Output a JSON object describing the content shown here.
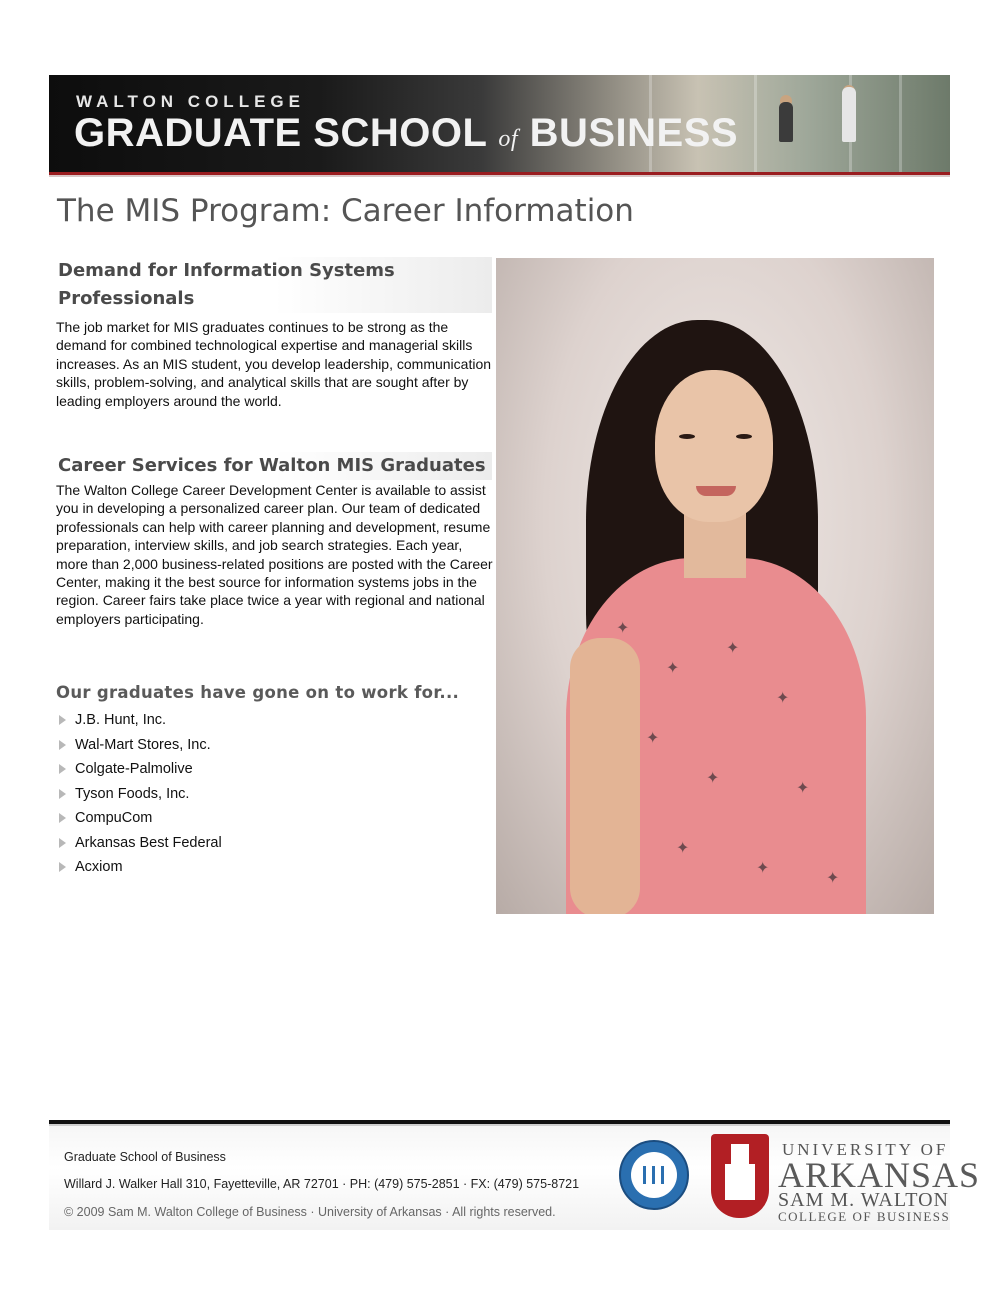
{
  "banner": {
    "kicker": "WALTON COLLEGE",
    "title_part1": "GRADUATE SCHOOL ",
    "title_of": "of",
    "title_part2": " BUSINESS"
  },
  "page_title": "The MIS Program: Career Information",
  "sections": [
    {
      "heading_line1": "Demand for Information Systems",
      "heading_line2": "Professionals",
      "body": "The job market for MIS graduates continues to be strong as the demand for combined technological expertise and managerial skills increases.  As an MIS student, you develop leadership, communication skills, problem-solving, and analytical skills that are sought after by leading employers around the world."
    },
    {
      "heading": "Career Services for Walton MIS Graduates",
      "body": "The Walton College Career Development Center is available to assist you in developing a personalized career plan. Our team of dedicated professionals can help with career planning and development, resume preparation, interview skills, and job search strategies.     Each year, more than 2,000 business-related positions are posted with the Career Center, making it the best source for information systems jobs in the region.  Career fairs take place twice a year with regional and national employers participating."
    }
  ],
  "graduates": {
    "heading": "Our graduates have gone on to work for...",
    "employers": [
      "J.B. Hunt, Inc.",
      "Wal-Mart Stores, Inc.",
      "Colgate-Palmolive",
      "Tyson Foods, Inc.",
      "CompuCom",
      "Arkansas Best Federal",
      "Acxiom"
    ]
  },
  "footer": {
    "line1": "Graduate School of Business",
    "line2": "Willard J. Walker Hall 310, Fayetteville, AR 72701 · PH: (479) 575-2851 · FX: (479) 575-8721",
    "line3": "© 2009 Sam M. Walton College of Business · University of Arkansas · All rights reserved.",
    "logo_line1": "UNIVERSITY OF",
    "logo_line2": "ARKANSAS",
    "logo_line3": "SAM M. WALTON",
    "logo_line4": "COLLEGE OF BUSINESS"
  }
}
